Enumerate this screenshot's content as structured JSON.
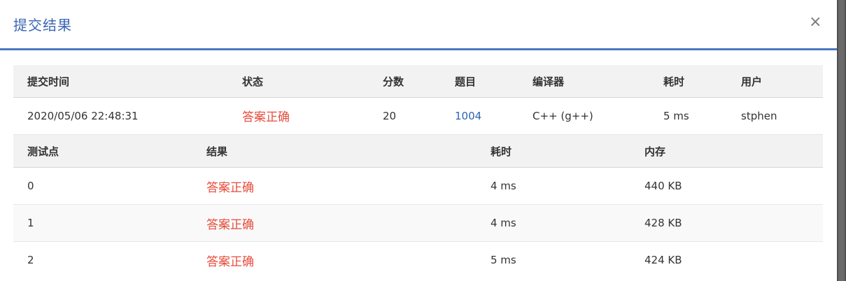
{
  "modal": {
    "title": "提交结果",
    "close_label": "×"
  },
  "submission_table": {
    "headers": [
      "提交时间",
      "状态",
      "分数",
      "题目",
      "编译器",
      "耗时",
      "用户"
    ],
    "row": {
      "time": "2020/05/06 22:48:31",
      "status": "答案正确",
      "score": "20",
      "problem": "1004",
      "compiler": "C++ (g++)",
      "duration": "5 ms",
      "user": "stphen"
    }
  },
  "testcase_table": {
    "headers": [
      "测试点",
      "结果",
      "耗时",
      "内存"
    ],
    "rows": [
      {
        "id": "0",
        "result": "答案正确",
        "time": "4 ms",
        "memory": "440 KB"
      },
      {
        "id": "1",
        "result": "答案正确",
        "time": "4 ms",
        "memory": "428 KB"
      },
      {
        "id": "2",
        "result": "答案正确",
        "time": "5 ms",
        "memory": "424 KB"
      }
    ]
  },
  "colors": {
    "accent": "#4a78c0",
    "title": "#3b67b4",
    "success_red": "#e74c3c",
    "link": "#2a64b3"
  }
}
